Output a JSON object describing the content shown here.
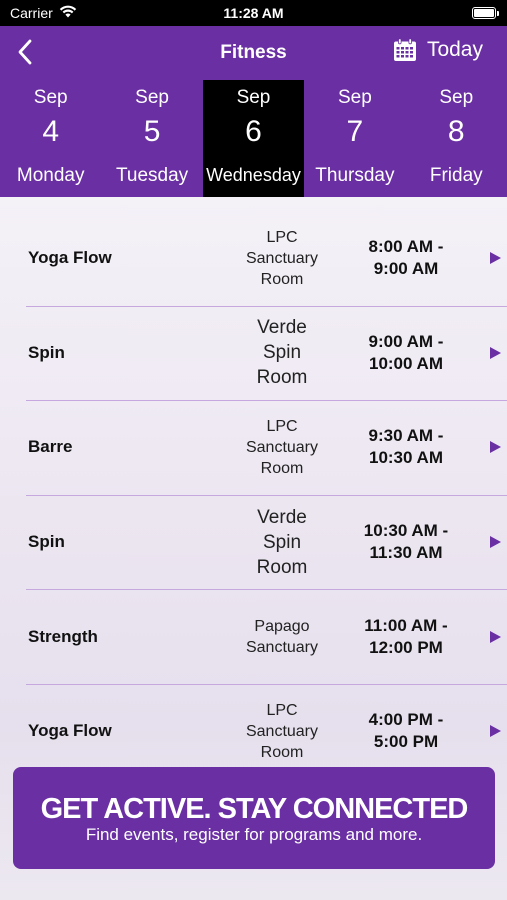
{
  "status_bar": {
    "carrier": "Carrier",
    "time": "11:28 AM"
  },
  "header": {
    "title": "Fitness",
    "today_label": "Today"
  },
  "days": [
    {
      "month": "Sep",
      "day": "4",
      "weekday": "Monday",
      "selected": false
    },
    {
      "month": "Sep",
      "day": "5",
      "weekday": "Tuesday",
      "selected": false
    },
    {
      "month": "Sep",
      "day": "6",
      "weekday": "Wednesday",
      "selected": true
    },
    {
      "month": "Sep",
      "day": "7",
      "weekday": "Thursday",
      "selected": false
    },
    {
      "month": "Sep",
      "day": "8",
      "weekday": "Friday",
      "selected": false
    }
  ],
  "classes": [
    {
      "name": "Yoga Flow",
      "location": [
        "LPC",
        "Sanctuary",
        "Room"
      ],
      "time": [
        "8:00 AM -",
        "9:00 AM"
      ]
    },
    {
      "name": "Spin",
      "location": [
        "Verde",
        "Spin",
        "Room"
      ],
      "time": [
        "9:00 AM -",
        "10:00 AM"
      ]
    },
    {
      "name": "Barre",
      "location": [
        "LPC",
        "Sanctuary",
        "Room"
      ],
      "time": [
        "9:30 AM -",
        "10:30 AM"
      ]
    },
    {
      "name": "Spin",
      "location": [
        "Verde",
        "Spin",
        "Room"
      ],
      "time": [
        "10:30 AM -",
        "11:30 AM"
      ]
    },
    {
      "name": "Strength",
      "location": [
        "Papago",
        "Sanctuary"
      ],
      "time": [
        "11:00 AM -",
        "12:00 PM"
      ]
    },
    {
      "name": "Yoga Flow",
      "location": [
        "LPC",
        "Sanctuary",
        "Room"
      ],
      "time": [
        "4:00 PM -",
        "5:00 PM"
      ]
    }
  ],
  "banner": {
    "title": "GET ACTIVE.  STAY CONNECTED",
    "subtitle": "Find events, register for programs and more."
  },
  "icons": {
    "back": "chevron-left-icon",
    "calendar": "calendar-icon",
    "row_arrow": "play-arrow-icon"
  },
  "colors": {
    "brand_purple": "#6a2fa2",
    "selected_day_bg": "#000000",
    "divider": "#c6a8de"
  }
}
